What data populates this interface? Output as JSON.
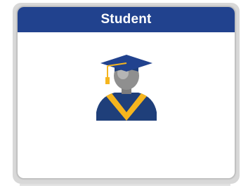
{
  "card": {
    "title": "Student",
    "icon": "graduate-avatar-icon",
    "colors": {
      "header_bg": "#21428e",
      "title_text": "#ffffff",
      "gown": "#1f3f7a",
      "stole": "#f5b51e",
      "face": "#8a8a8a",
      "tassel": "#f5b51e"
    }
  }
}
